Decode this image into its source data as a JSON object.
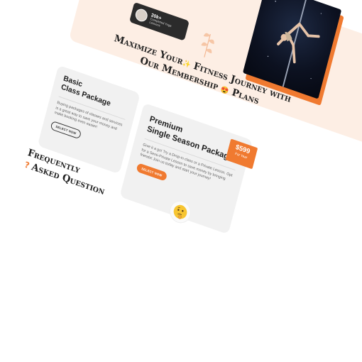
{
  "hero": {
    "stat_number": "20k+",
    "stat_caption": "Completed Yoga Lessons",
    "photo_alt": "pole-dancer-photo"
  },
  "membership": {
    "heading_line1_a": "Maximize Your",
    "heading_line1_b": "Fitness Journey with",
    "heading_line2_a": "Our Membership",
    "heading_line2_b": "Plans",
    "emoji_a": "✨",
    "emoji_b": "😍"
  },
  "plans": [
    {
      "title_line1": "Basic",
      "title_line2": "Class Package",
      "description": "Buying packages of classes and services is a great way to save your money and make booking even easier!",
      "button_label": "SELECT NOW"
    },
    {
      "title_line1": "Premium",
      "title_line2": "Single Season Package",
      "description": "Give it a go! Try a Drop-in class or a Private Lesson. Opt for a Semi-Private Lesson to save money by bringing friends! Join us today and start your journey!",
      "button_label": "SELECT NOW",
      "price": "$599",
      "price_period": "For Year"
    }
  ],
  "faq": {
    "line1": "Frequently",
    "q_mark": "?",
    "line2": "Asked Question"
  },
  "colors": {
    "accent": "#f07a30",
    "peach": "#fdeee4",
    "card": "#f1f1f1",
    "text": "#202020"
  },
  "icons": {
    "leaf": "leaf-icon",
    "emoji": "thinking-face-emoji"
  }
}
